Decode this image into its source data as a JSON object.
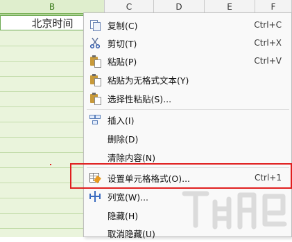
{
  "sheet": {
    "columns": [
      "B",
      "C",
      "D",
      "E",
      "F"
    ],
    "cell_a1": "北京时间"
  },
  "menu": {
    "items": [
      {
        "label": "复制(C)",
        "shortcut": "Ctrl+C",
        "icon": "copy-icon"
      },
      {
        "label": "剪切(T)",
        "shortcut": "Ctrl+X",
        "icon": "scissors-icon"
      },
      {
        "label": "粘贴(P)",
        "shortcut": "Ctrl+V",
        "icon": "paste-icon"
      },
      {
        "label": "粘贴为无格式文本(Y)",
        "shortcut": "",
        "icon": "paste-text-icon"
      },
      {
        "label": "选择性粘贴(S)...",
        "shortcut": "",
        "icon": "paste-special-icon"
      },
      {
        "label": "插入(I)",
        "shortcut": "",
        "icon": "insert-cells-icon"
      },
      {
        "label": "删除(D)",
        "shortcut": "",
        "icon": ""
      },
      {
        "label": "清除内容(N)",
        "shortcut": "",
        "icon": ""
      },
      {
        "label": "设置单元格格式(O)...",
        "shortcut": "Ctrl+1",
        "icon": "format-cells-icon"
      },
      {
        "label": "列宽(W)...",
        "shortcut": "",
        "icon": "column-width-icon"
      },
      {
        "label": "隐藏(H)",
        "shortcut": "",
        "icon": ""
      },
      {
        "label": "取消隐藏(U)",
        "shortcut": "",
        "icon": ""
      }
    ]
  },
  "colors": {
    "highlight_border": "#e01e1e",
    "selected_column": "#eaf4dc",
    "selected_header_text": "#3a7a1a"
  }
}
